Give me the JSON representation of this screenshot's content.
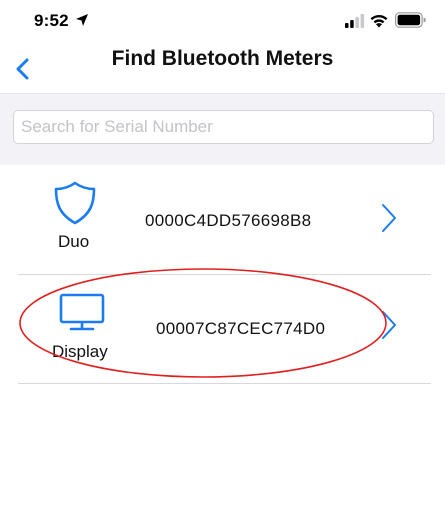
{
  "status_bar": {
    "time": "9:52",
    "icons": [
      "location-arrow-icon",
      "cellular-signal-icon",
      "wifi-icon",
      "battery-icon"
    ]
  },
  "nav": {
    "title": "Find Bluetooth Meters",
    "back_icon": "chevron-left-icon"
  },
  "search": {
    "placeholder": "Search for Serial Number",
    "value": ""
  },
  "meters": [
    {
      "type_label": "Duo",
      "icon": "shield-icon",
      "serial": "0000C4DD576698B8"
    },
    {
      "type_label": "Display",
      "icon": "monitor-icon",
      "serial": "00007C87CEC774D0"
    }
  ],
  "colors": {
    "accent": "#1a7cf0",
    "highlight": "#e0201f",
    "search_background": "#f2f2f7",
    "divider": "#d9d9dd"
  }
}
